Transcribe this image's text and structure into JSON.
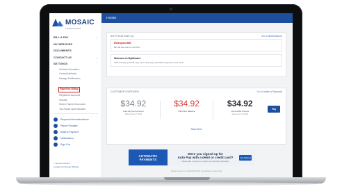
{
  "logo": {
    "name": "MOSAIC",
    "tagline": "TECHNOLOGIES"
  },
  "topbar": {
    "title": "HOME"
  },
  "sidebar": {
    "sections": [
      {
        "label": "Bill & Pay"
      },
      {
        "label": "My Services"
      },
      {
        "label": "Documents"
      },
      {
        "label": "Contact Us"
      },
      {
        "label": "Settings"
      }
    ],
    "settings_items": [
      "Contact Information",
      "Contact Methods",
      "Manage Notifications",
      "Paperless Billing",
      "Registered Accounts",
      "Security",
      "Stored Payment Accounts",
      "Two-Factor Authentication"
    ],
    "quick_links": [
      "Request Information/Issue",
      "Report Outages",
      "Make A Payment",
      "Notifications",
      "Sign Out"
    ],
    "footer_links": [
      "< Mosaic Website",
      "Contact Us Mosaic Website"
    ]
  },
  "notifications": {
    "header": "NOTIFICATIONS (2)",
    "link": "Go to Notifications",
    "alerts": [
      {
        "title": "Delinquent Bill",
        "text": "$34.92 was due on 12/15/xx"
      },
      {
        "title": "Welcome to MyMosaic!",
        "text": "View and pay your bill, sign up for auto pay, schedule a payment, and more!"
      }
    ]
  },
  "overview": {
    "header": "CUSTOMER OVERVIEW",
    "link": "Go to Make a Payment",
    "balances": [
      {
        "amount": "$34.92",
        "label": "Last Payment Amount",
        "sub": "Paid on Nov 27 2024"
      },
      {
        "amount": "$34.92",
        "label": "Past Due Balance",
        "sub": ""
      },
      {
        "amount": "$34.92",
        "label": "Current Bill Amount",
        "sub": "Due on Jan 15 2025"
      }
    ],
    "pay_button": "Pay",
    "more_link": "Show More"
  },
  "promo": {
    "left_line1": "AUTOMATIC",
    "left_line2": "PAYMENTS",
    "headline1": "Were you signed up for",
    "headline2": "Auto Pay with a debit or credit card?",
    "subtext": "Please take a minute to re-setup your Auto Pay information",
    "button": "Get Started"
  },
  "bottom_text": "Need Support | 1-800-000-0000 | Feedback | Help FAQ",
  "colors": {
    "brand_blue": "#1d4f9e",
    "alert_red": "#c4161c",
    "active_border": "#d11a1a"
  }
}
